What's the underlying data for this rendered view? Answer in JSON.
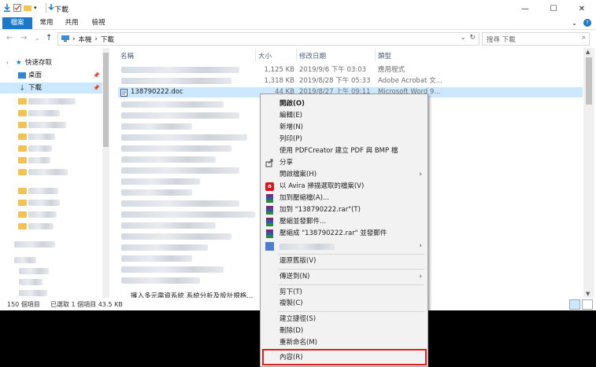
{
  "window": {
    "title": "下載",
    "controls": {
      "minimize": "—",
      "maximize": "☐",
      "close": "✕"
    }
  },
  "ribbon": {
    "tabs": [
      "檔案",
      "常用",
      "共用",
      "檢視"
    ],
    "help_badge": "?"
  },
  "nav": {
    "breadcrumb": [
      "本機",
      "下載"
    ],
    "search_placeholder": "搜尋 下載"
  },
  "sidebar": {
    "quick_access": "快速存取",
    "items": [
      {
        "label": "桌面",
        "icon": "desktop-icon"
      },
      {
        "label": "下載",
        "icon": "download-icon"
      }
    ]
  },
  "columns": {
    "name": "名稱",
    "size": "大小",
    "date": "修改日期",
    "type": "類型"
  },
  "files": [
    {
      "name": "",
      "size": "1,125 KB",
      "date": "2019/9/6 下午 03:03",
      "type": "應用程式"
    },
    {
      "name": "",
      "size": "1,318 KB",
      "date": "2019/8/28 下午 05:33",
      "type": "Adobe Acrobat 文..."
    },
    {
      "name": "138790222.doc",
      "size": "44 KB",
      "date": "2019/8/27 上午 09:11",
      "type": "Microsoft Word 9..."
    }
  ],
  "bottom_file_partial": "擁入多元需資系統 系統分析及設計規格...",
  "status": {
    "count": "150 個項目",
    "selected": "已選取 1 個項目  43.5 KB"
  },
  "context_menu": {
    "items": [
      {
        "label": "開啟(O)",
        "bold": true
      },
      {
        "label": "編輯(E)"
      },
      {
        "label": "新增(N)"
      },
      {
        "label": "列印(P)"
      },
      {
        "label": "使用 PDFCreator 建立 PDF 與 BMP 檔"
      },
      {
        "label": "分享",
        "icon": "share-icon"
      },
      {
        "label": "開啟檔案(H)",
        "submenu": true
      },
      {
        "label": "以 Avira 掃描選取的檔案(V)",
        "icon": "avira-icon"
      },
      {
        "label": "加到壓縮檔(A)...",
        "icon": "winrar-icon"
      },
      {
        "label": "加到 \"138790222.rar\"(T)",
        "icon": "winrar-icon"
      },
      {
        "label": "壓縮並發郵件...",
        "icon": "winrar-icon"
      },
      {
        "label": "壓縮成 \"138790222.rar\" 並發郵件",
        "icon": "winrar-icon"
      },
      {
        "label": "",
        "submenu": true,
        "icon": "app-icon"
      },
      {
        "label": "還原舊版(V)"
      },
      {
        "label": "傳送到(N)",
        "submenu": true
      },
      {
        "label": "剪下(T)"
      },
      {
        "label": "複製(C)"
      },
      {
        "label": "建立捷徑(S)"
      },
      {
        "label": "刪除(D)"
      },
      {
        "label": "重新命名(M)"
      },
      {
        "label": "內容(R)"
      }
    ]
  }
}
